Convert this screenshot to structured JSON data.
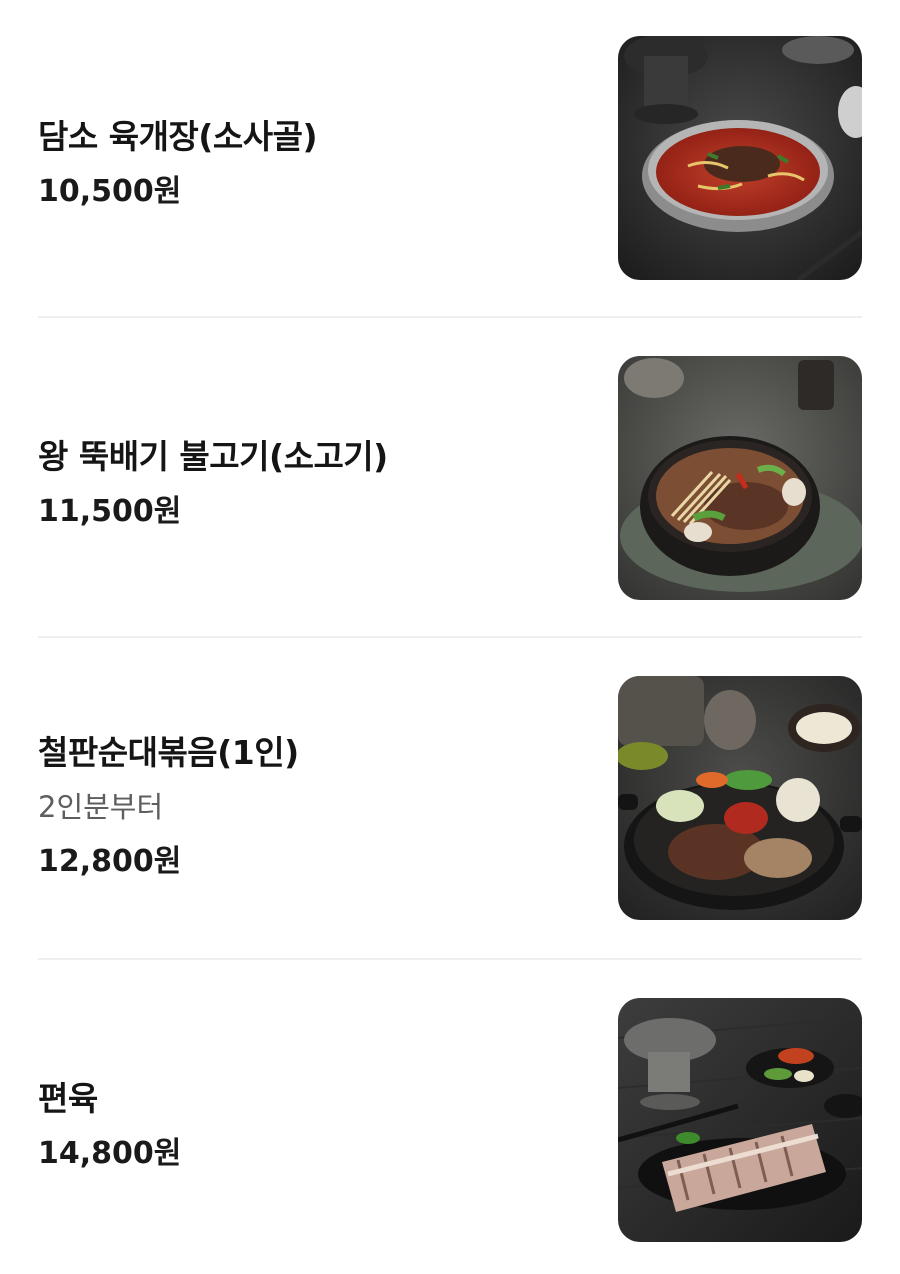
{
  "menu": {
    "items": [
      {
        "name": "담소 육개장(소사골)",
        "description": "",
        "price": "10,500원",
        "image_icon": "yukgaejang-photo"
      },
      {
        "name": "왕 뚝배기 불고기(소고기)",
        "description": "",
        "price": "11,500원",
        "image_icon": "bulgogi-photo"
      },
      {
        "name": "철판순대볶음(1인)",
        "description": "2인분부터",
        "price": "12,800원",
        "image_icon": "sundae-bokkeum-photo"
      },
      {
        "name": "편육",
        "description": "",
        "price": "14,800원",
        "image_icon": "pyeonyuk-photo"
      }
    ]
  }
}
